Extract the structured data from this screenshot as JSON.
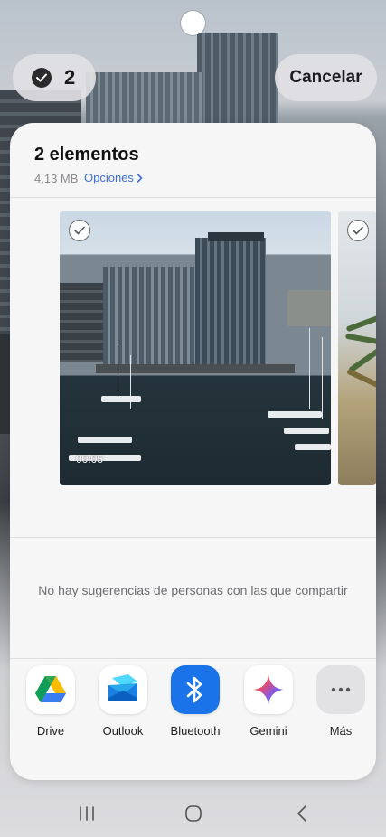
{
  "top_bar": {
    "selected_count": "2",
    "cancel_label": "Cancelar"
  },
  "sheet": {
    "title": "2 elementos",
    "size": "4,13 MB",
    "options_label": "Opciones",
    "thumbnails": [
      {
        "duration": "00:05",
        "selected": true
      },
      {
        "selected": true
      }
    ],
    "no_suggestions_text": "No hay sugerencias de personas con las que compartir"
  },
  "apps": [
    {
      "label": "Drive",
      "icon": "google-drive-icon"
    },
    {
      "label": "Outlook",
      "icon": "outlook-icon"
    },
    {
      "label": "Bluetooth",
      "icon": "bluetooth-icon",
      "color": "#1a73e8"
    },
    {
      "label": "Gemini",
      "icon": "gemini-icon"
    },
    {
      "label": "Más",
      "icon": "more-icon"
    }
  ],
  "navbar": {
    "buttons": [
      "recents",
      "home",
      "back"
    ]
  }
}
